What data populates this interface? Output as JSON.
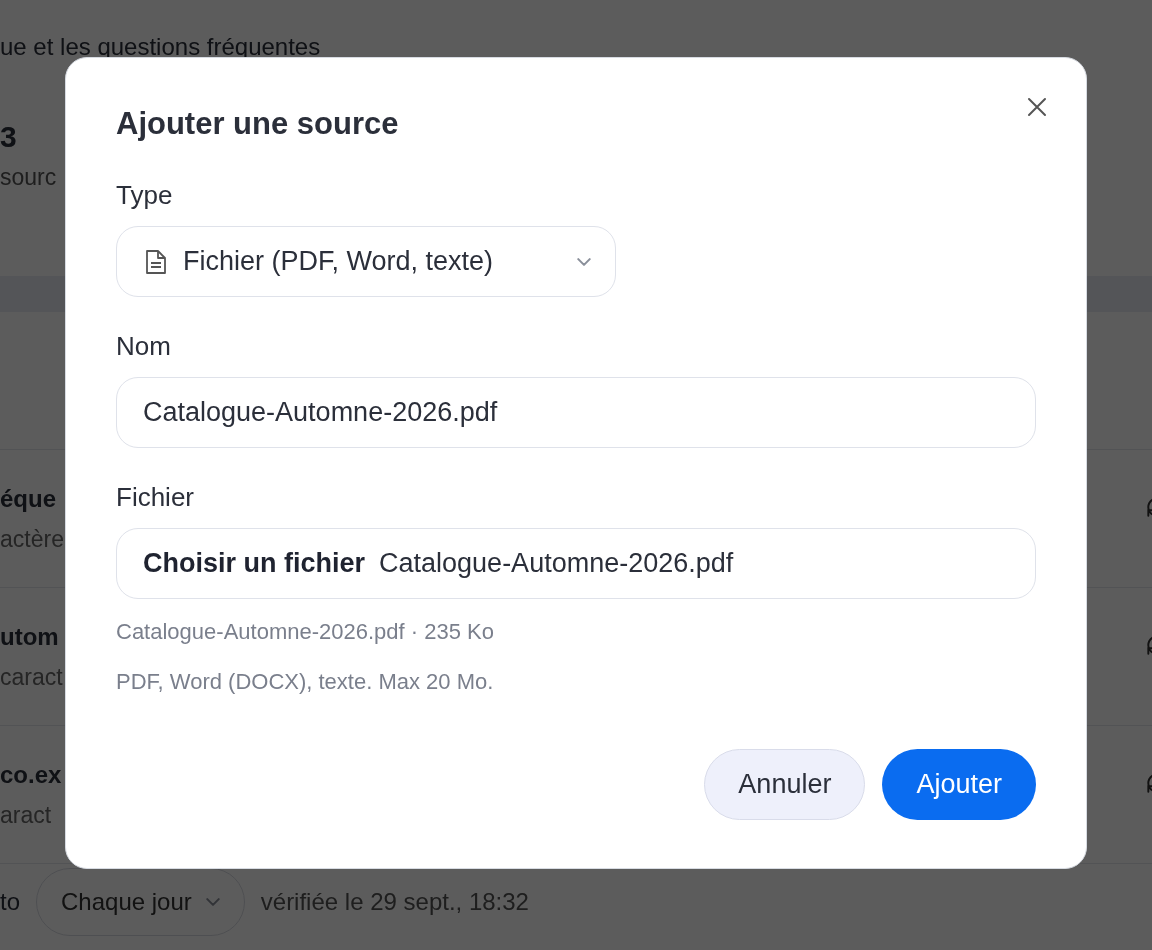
{
  "background": {
    "subtitle": "ue et les questions fréquentes",
    "stat": {
      "value": "3",
      "label": "sourc"
    },
    "sources": [
      {
        "name": "éque",
        "detail": "actère"
      },
      {
        "name": "utom",
        "detail": "caract"
      },
      {
        "name": "co.ex",
        "detail": "aract"
      }
    ],
    "schedule": {
      "label": "to",
      "frequency": "Chaque jour",
      "last_checked": "vérifiée le 29 sept., 18:32"
    }
  },
  "dialog": {
    "title": "Ajouter une source",
    "fields": [
      {
        "kind": "select",
        "label": "Type",
        "value": "Fichier (PDF, Word, texte)"
      },
      {
        "kind": "text",
        "label": "Nom",
        "value": "Catalogue-Automne-2026.pdf"
      },
      {
        "kind": "file",
        "label": "Fichier",
        "button": "Choisir un fichier",
        "value": "Catalogue-Automne-2026.pdf",
        "hints": [
          "Catalogue-Automne-2026.pdf · 235 Ko",
          "PDF, Word (DOCX), texte. Max 20 Mo."
        ]
      }
    ],
    "buttons": [
      {
        "kind": "secondary",
        "label": "Annuler"
      },
      {
        "kind": "primary",
        "label": "Ajouter"
      }
    ]
  }
}
